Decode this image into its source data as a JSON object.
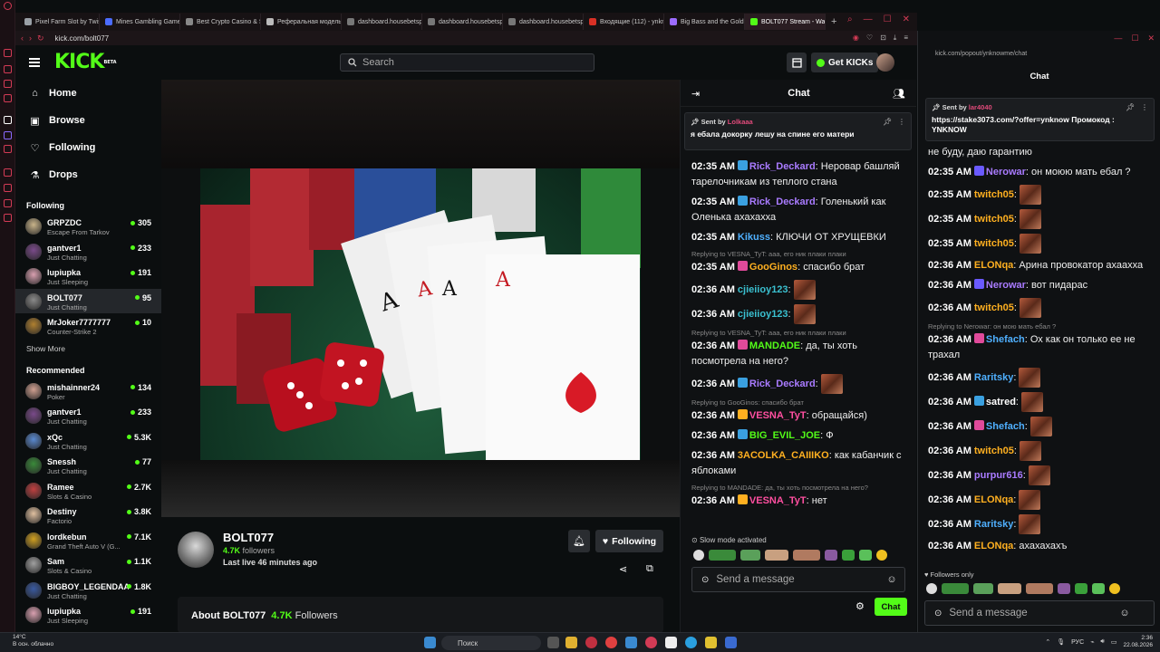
{
  "browser": {
    "tabs": [
      {
        "label": "Pixel Farm Slot by Twist",
        "color": "#9aa0a6"
      },
      {
        "label": "Mines Gambling Game",
        "color": "#4b6cff"
      },
      {
        "label": "Best Crypto Casino & Sp",
        "color": "#888888"
      },
      {
        "label": "Реферальная модель",
        "color": "#bbbbbb"
      },
      {
        "label": "dashboard.housebetsp",
        "color": "#777777"
      },
      {
        "label": "dashboard.housebetsp",
        "color": "#777777"
      },
      {
        "label": "dashboard.housebetsp",
        "color": "#777777"
      },
      {
        "label": "Входящие (112) - ynkno",
        "color": "#d93025"
      },
      {
        "label": "Big Bass and the Gold",
        "color": "#9c6cff"
      },
      {
        "label": "BOLT077 Stream - Watch",
        "color": "#53fc18"
      }
    ],
    "url": "kick.com/bolt077"
  },
  "header": {
    "logo": "KICK",
    "logo_badge": "BETA",
    "search_placeholder": "Search",
    "get_kicks": "Get KICKs"
  },
  "sidebar": {
    "nav": [
      {
        "label": "Home",
        "icon": "home-icon",
        "glyph": "⌂"
      },
      {
        "label": "Browse",
        "icon": "browse-icon",
        "glyph": "▣"
      },
      {
        "label": "Following",
        "icon": "heart-icon",
        "glyph": "♡"
      },
      {
        "label": "Drops",
        "icon": "drops-icon",
        "glyph": "⚗"
      }
    ],
    "following_heading": "Following",
    "following": [
      {
        "name": "GRPZDC",
        "category": "Escape From Tarkov",
        "viewers": "305",
        "color": "#c9b48a"
      },
      {
        "name": "gantver1",
        "category": "Just Chatting",
        "viewers": "233",
        "color": "#7a4a8a"
      },
      {
        "name": "lupiupka",
        "category": "Just Sleeping",
        "viewers": "191",
        "color": "#d9a0b0"
      },
      {
        "name": "BOLT077",
        "category": "Just Chatting",
        "viewers": "95",
        "color": "#8a8a8a"
      },
      {
        "name": "MrJoker7777777",
        "category": "Counter-Strike 2",
        "viewers": "10",
        "color": "#b08030"
      }
    ],
    "show_more": "Show More",
    "recommended_heading": "Recommended",
    "recommended": [
      {
        "name": "mishainner24",
        "category": "Poker",
        "viewers": "134",
        "color": "#d0a090"
      },
      {
        "name": "gantver1",
        "category": "Just Chatting",
        "viewers": "233",
        "color": "#7a4a8a"
      },
      {
        "name": "xQc",
        "category": "Just Chatting",
        "viewers": "5.3K",
        "color": "#5a8ad0"
      },
      {
        "name": "Snessh",
        "category": "Just Chatting",
        "viewers": "77",
        "color": "#3a8a3a"
      },
      {
        "name": "Ramee",
        "category": "Slots & Casino",
        "viewers": "2.7K",
        "color": "#c04040"
      },
      {
        "name": "Destiny",
        "category": "Factorio",
        "viewers": "3.8K",
        "color": "#e0c0a0"
      },
      {
        "name": "lordkebun",
        "category": "Grand Theft Auto V (G...",
        "viewers": "7.1K",
        "color": "#d0a020"
      },
      {
        "name": "Sam",
        "category": "Slots & Casino",
        "viewers": "1.1K",
        "color": "#a0a0a0"
      },
      {
        "name": "BIGBOY_LEGENDAA",
        "category": "Just Chatting",
        "viewers": "1.8K",
        "color": "#3a5aa0"
      },
      {
        "name": "lupiupka",
        "category": "Just Sleeping",
        "viewers": "191",
        "color": "#d9a0b0"
      }
    ]
  },
  "stream": {
    "streamer": "BOLT077",
    "followers": "4.7K",
    "followers_label": "followers",
    "last_live": "Last live 46 minutes ago",
    "following_label": "Following",
    "about_title": "About BOLT077",
    "about_followers": "4.7K",
    "about_followers_label": "Followers"
  },
  "chat1": {
    "title": "Chat",
    "pinned": {
      "sent_by": "Sent by",
      "user": "Lolkaaa",
      "text": "я ебала докорку лешу на спине его матери"
    },
    "messages": [
      {
        "time": "02:35 AM",
        "user": "Rick_Deckard",
        "color": "#a97bff",
        "text": "Неровар башляй тарелочникам из теплого стана",
        "badge": "#3aa0e0"
      },
      {
        "time": "02:35 AM",
        "user": "Rick_Deckard",
        "color": "#a97bff",
        "text": "Голенький как Оленька ахахахха",
        "badge": "#3aa0e0"
      },
      {
        "time": "02:35 AM",
        "user": "Kikuss",
        "color": "#4fb0ff",
        "text": "КЛЮЧИ ОТ ХРУЩЕВКИ",
        "badge": ""
      },
      {
        "reply": "Replying to VESNA_TyT: aaa, его ник плаки плаки",
        "time": "02:35 AM",
        "user": "GooGinos",
        "color": "#ffb020",
        "text": "спасибо брат",
        "badge": "#e04a9a"
      },
      {
        "time": "02:36 AM",
        "user": "cjieiioy123",
        "color": "#3ac0d0",
        "text": "",
        "badge": ""
      },
      {
        "time": "02:36 AM",
        "user": "cjieiioy123",
        "color": "#3ac0d0",
        "text": "",
        "badge": ""
      },
      {
        "reply": "Replying to VESNA_TyT: aaa, его ник плаки плаки",
        "time": "02:36 AM",
        "user": "MANDADE",
        "color": "#53fc18",
        "text": "да, ты хоть посмотрела на него?",
        "badge": "#e04a9a"
      },
      {
        "time": "02:36 AM",
        "user": "Rick_Deckard",
        "color": "#a97bff",
        "text": "",
        "badge": "#3aa0e0"
      },
      {
        "reply": "Replying to GooGinos: спасибо брат",
        "time": "02:36 AM",
        "user": "VESNA_TyT",
        "color": "#ff4fa0",
        "text": "обращайся)",
        "badge": "#ffb020"
      },
      {
        "time": "02:36 AM",
        "user": "BIG_EVIL_JOE",
        "color": "#53fc18",
        "text": "Ф",
        "badge": "#3aa0e0"
      },
      {
        "time": "02:36 AM",
        "user": "3ACOLKA_CAIIIKO",
        "color": "#ffb020",
        "text": "как кабанчик с яблоками",
        "badge": ""
      },
      {
        "reply": "Replying to MANDADE: да, ты хоть посмотрела на него?",
        "time": "02:36 AM",
        "user": "VESNA_TyT",
        "color": "#ff4fa0",
        "text": "нет",
        "badge": "#ffb020"
      }
    ],
    "slow_mode": "Slow mode activated",
    "input_placeholder": "Send a message",
    "send": "Chat"
  },
  "popout": {
    "url": "kick.com/popout/ynknowme/chat",
    "title": "Chat",
    "pinned": {
      "sent_by": "Sent by",
      "user": "lar4040",
      "text": "https://stake3073.com/?offer=ynknow Промокод : YNKNOW"
    },
    "messages": [
      {
        "time": "",
        "user": "",
        "color": "#ffffff",
        "text": "не буду, даю гарантию",
        "badge": ""
      },
      {
        "time": "02:35 AM",
        "user": "Nerowar",
        "color": "#a97bff",
        "text": "он моюю мать ебал ?",
        "badge": "#6a5aff"
      },
      {
        "time": "02:35 AM",
        "user": "twitch05",
        "color": "#ffb020",
        "text": "",
        "badge": ""
      },
      {
        "time": "02:35 AM",
        "user": "twitch05",
        "color": "#ffb020",
        "text": "",
        "badge": ""
      },
      {
        "time": "02:35 AM",
        "user": "twitch05",
        "color": "#ffb020",
        "text": "",
        "badge": ""
      },
      {
        "time": "02:36 AM",
        "user": "ELONqa",
        "color": "#ffb020",
        "text": "Арина провокатор ахаахха",
        "badge": ""
      },
      {
        "time": "02:36 AM",
        "user": "Nerowar",
        "color": "#a97bff",
        "text": "вот пидарас",
        "badge": "#6a5aff"
      },
      {
        "time": "02:36 AM",
        "user": "twitch05",
        "color": "#ffb020",
        "text": "",
        "badge": ""
      },
      {
        "reply": "Replying to Nerowar: он мою мать ебал ?",
        "time": "02:36 AM",
        "user": "Shefach",
        "color": "#4fb0ff",
        "text": "Ох как он только ее не трахал",
        "badge": "#e04a9a"
      },
      {
        "time": "02:36 AM",
        "user": "Raritsky",
        "color": "#4fb0ff",
        "text": "",
        "badge": ""
      },
      {
        "time": "02:36 AM",
        "user": "satred",
        "color": "#ffffff",
        "text": "",
        "badge": "#3aa0e0"
      },
      {
        "time": "02:36 AM",
        "user": "Shefach",
        "color": "#4fb0ff",
        "text": "",
        "badge": "#e04a9a"
      },
      {
        "time": "02:36 AM",
        "user": "twitch05",
        "color": "#ffb020",
        "text": "",
        "badge": ""
      },
      {
        "time": "02:36 AM",
        "user": "purpur616",
        "color": "#a97bff",
        "text": "",
        "badge": ""
      },
      {
        "time": "02:36 AM",
        "user": "ELONqa",
        "color": "#ffb020",
        "text": "",
        "badge": ""
      },
      {
        "time": "02:36 AM",
        "user": "Raritsky",
        "color": "#4fb0ff",
        "text": "",
        "badge": ""
      },
      {
        "time": "02:36 AM",
        "user": "ELONqa",
        "color": "#ffb020",
        "text": "ахахахахъ",
        "badge": ""
      }
    ],
    "followers_only": "Followers only",
    "input_placeholder": "Send a message"
  },
  "taskbar": {
    "weather_temp": "14°C",
    "weather_desc": "В осн. облачно",
    "search": "Поиск",
    "lang": "РУС",
    "time": "2:36",
    "date": "22.08.2026"
  },
  "colors": {
    "accent": "#53fc18",
    "opera": "#d33b55"
  }
}
